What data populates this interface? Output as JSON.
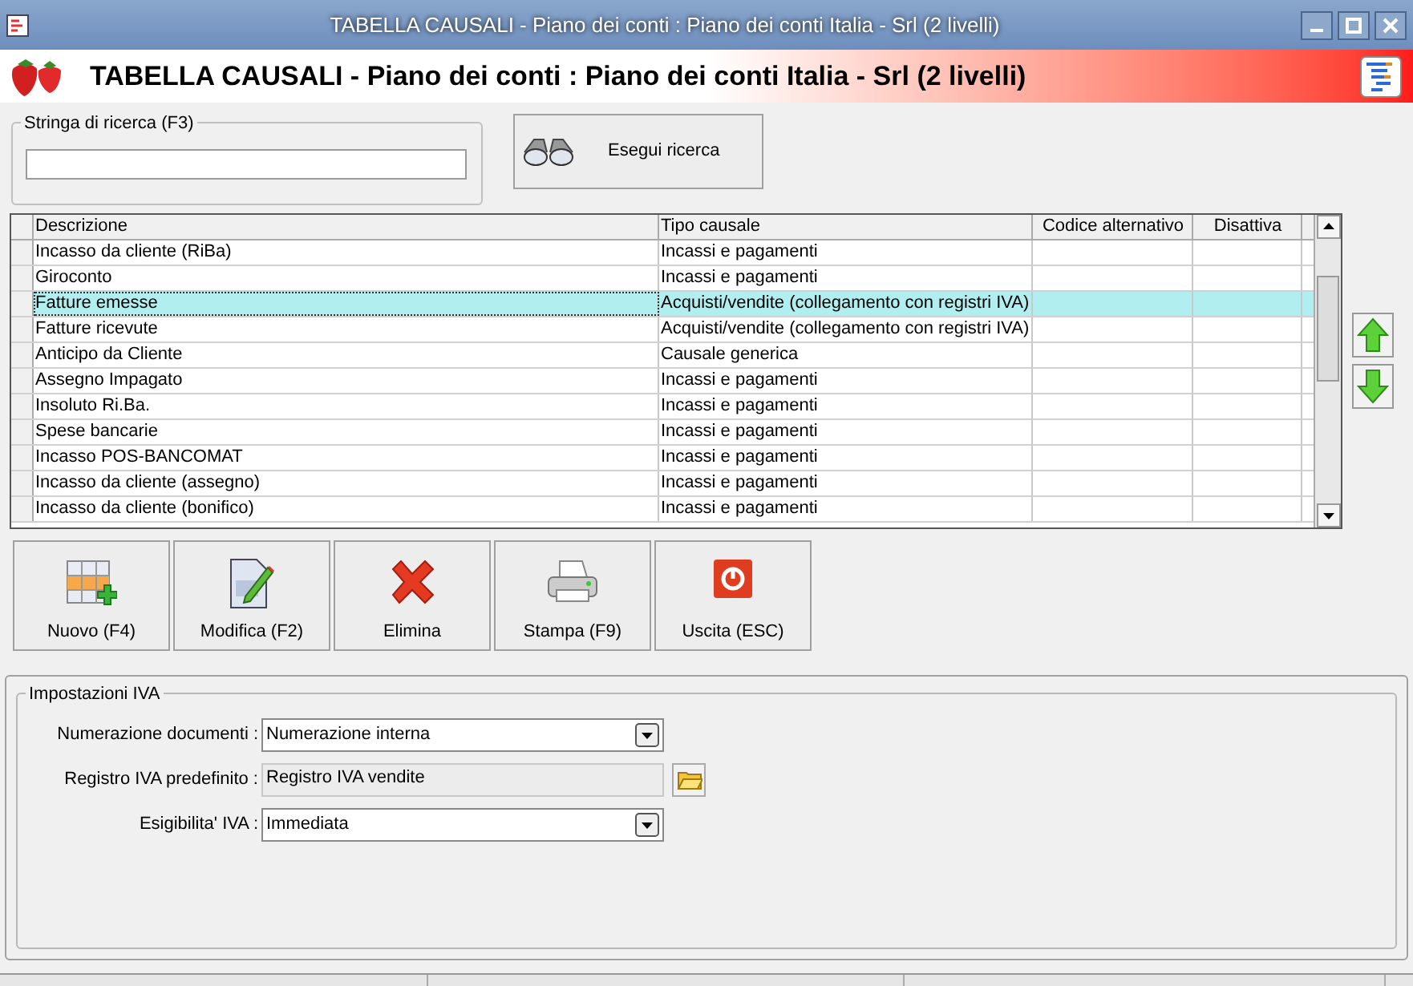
{
  "window": {
    "title": "TABELLA CAUSALI - Piano dei conti : Piano dei conti Italia - Srl (2 livelli)"
  },
  "header": {
    "title": "TABELLA CAUSALI - Piano dei conti : Piano dei conti Italia - Srl (2 livelli)"
  },
  "search": {
    "label": "Stringa di ricerca (F3)",
    "button": "Esegui ricerca"
  },
  "table": {
    "columns": [
      "Descrizione",
      "Tipo causale",
      "Codice alternativo",
      "Disattiva"
    ],
    "rows": [
      {
        "cells": [
          "Incasso da cliente (RiBa)",
          "Incassi e pagamenti",
          "",
          ""
        ],
        "selected": false
      },
      {
        "cells": [
          "Giroconto",
          "Incassi e pagamenti",
          "",
          ""
        ],
        "selected": false
      },
      {
        "cells": [
          "Fatture emesse",
          "Acquisti/vendite (collegamento con registri IVA)",
          "",
          ""
        ],
        "selected": true
      },
      {
        "cells": [
          "Fatture ricevute",
          "Acquisti/vendite (collegamento con registri IVA)",
          "",
          ""
        ],
        "selected": false
      },
      {
        "cells": [
          "Anticipo da Cliente",
          "Causale generica",
          "",
          ""
        ],
        "selected": false
      },
      {
        "cells": [
          "Assegno Impagato",
          "Incassi e pagamenti",
          "",
          ""
        ],
        "selected": false
      },
      {
        "cells": [
          "Insoluto Ri.Ba.",
          "Incassi e pagamenti",
          "",
          ""
        ],
        "selected": false
      },
      {
        "cells": [
          "Spese bancarie",
          "Incassi e pagamenti",
          "",
          ""
        ],
        "selected": false
      },
      {
        "cells": [
          "Incasso POS-BANCOMAT",
          "Incassi e pagamenti",
          "",
          ""
        ],
        "selected": false
      },
      {
        "cells": [
          "Incasso da cliente (assegno)",
          "Incassi e pagamenti",
          "",
          ""
        ],
        "selected": false
      },
      {
        "cells": [
          "Incasso da cliente (bonifico)",
          "Incassi e pagamenti",
          "",
          ""
        ],
        "selected": false
      }
    ]
  },
  "actions": [
    {
      "kind": "new",
      "label": "Nuovo (F4)"
    },
    {
      "kind": "edit",
      "label": "Modifica (F2)"
    },
    {
      "kind": "delete",
      "label": "Elimina"
    },
    {
      "kind": "print",
      "label": "Stampa (F9)"
    },
    {
      "kind": "exit",
      "label": "Uscita (ESC)"
    }
  ],
  "iva": {
    "title": "Impostazioni IVA",
    "fields": [
      {
        "kind": "select",
        "label": "Numerazione documenti :",
        "value": "Numerazione interna",
        "disabled": false
      },
      {
        "kind": "lookup",
        "label": "Registro IVA predefinito :",
        "value": "Registro IVA vendite",
        "disabled": true
      },
      {
        "kind": "select",
        "label": "Esigibilita' IVA :",
        "value": "Immediata",
        "disabled": false
      }
    ]
  }
}
